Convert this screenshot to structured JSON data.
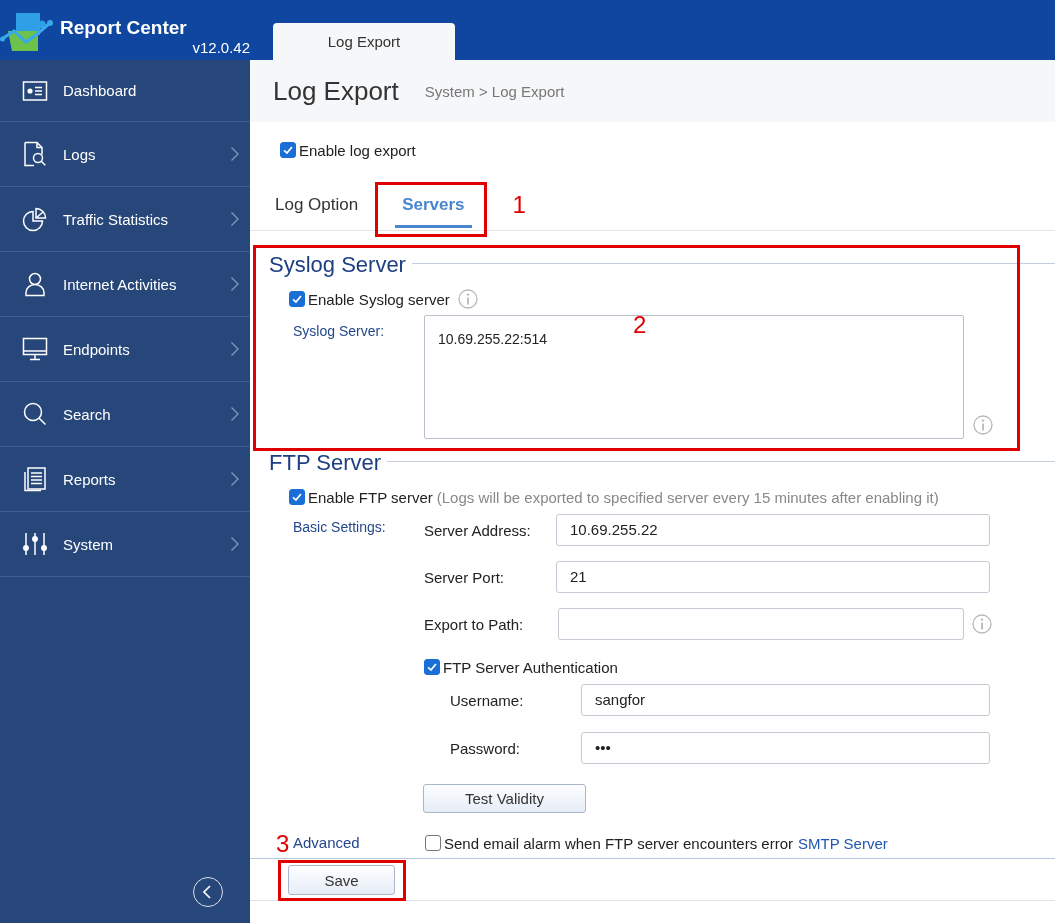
{
  "app": {
    "name": "Report Center",
    "version": "v12.0.42"
  },
  "open_tabs": [
    {
      "label": "Log Export",
      "selected": true
    }
  ],
  "sidebar": {
    "items": [
      {
        "label": "Dashboard",
        "has_submenu": false
      },
      {
        "label": "Logs",
        "has_submenu": true
      },
      {
        "label": "Traffic Statistics",
        "has_submenu": true
      },
      {
        "label": "Internet Activities",
        "has_submenu": true
      },
      {
        "label": "Endpoints",
        "has_submenu": true
      },
      {
        "label": "Search",
        "has_submenu": true
      },
      {
        "label": "Reports",
        "has_submenu": true
      },
      {
        "label": "System",
        "has_submenu": true
      }
    ]
  },
  "page_header": {
    "title": "Log Export",
    "breadcrumb": "System > Log Export"
  },
  "enable_log_export": {
    "label": "Enable log export",
    "checked": true
  },
  "section_tabs": [
    {
      "label": "Log Option",
      "selected": false
    },
    {
      "label": "Servers",
      "selected": true,
      "callout": "1"
    }
  ],
  "syslog": {
    "title": "Syslog Server",
    "callout": "2",
    "enable": {
      "label": "Enable Syslog server",
      "checked": true
    },
    "server_label": "Syslog Server:",
    "server_value": "10.69.255.22:514"
  },
  "ftp": {
    "title": "FTP Server",
    "enable": {
      "label": "Enable FTP server",
      "checked": true
    },
    "note": "(Logs will be exported to specified server every 15 minutes after enabling it)",
    "basic_label": "Basic Settings:",
    "fields": [
      {
        "label": "Server Address:",
        "value": "10.69.255.22"
      },
      {
        "label": "Server Port:",
        "value": "21"
      },
      {
        "label": "Export to Path:",
        "info_icon": true
      }
    ],
    "auth": {
      "label": "FTP Server Authentication",
      "checked": true,
      "fields": [
        {
          "label": "Username:",
          "value": "sangfor"
        },
        {
          "label": "Password:",
          "value": "•••"
        }
      ]
    },
    "test_button": "Test Validity",
    "advanced_label": "Advanced",
    "email_alarm": {
      "label": "Send email alarm when FTP server encounters error",
      "checked": false
    },
    "smtp_link": "SMTP Server"
  },
  "footer": {
    "save_button": "Save",
    "callout": "3"
  }
}
